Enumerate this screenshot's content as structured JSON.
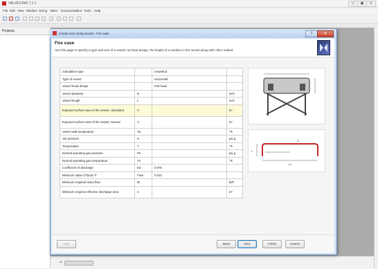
{
  "app": {
    "title": "VALVESTAR 7.2.1",
    "win_controls": [
      "▭",
      "▣",
      "✕"
    ]
  },
  "menu": [
    "File",
    "Edit",
    "View",
    "Medium",
    "Sizing",
    "Valve",
    "Documentation",
    "Tools",
    "Help"
  ],
  "projects_panel": {
    "title": "Projects"
  },
  "dialog": {
    "title": "Create new sizing wizard - Fire case",
    "help_label": "?",
    "close_label": "✕",
    "heading": "Fire case",
    "description": "Use this page to specify a type and size of a vessel, its head design, the height of a medium in the vessel along with other related",
    "rows": [
      {
        "label": "Calculation type",
        "symbol": "",
        "value": "Unwetted",
        "unit": ""
      },
      {
        "label": "Type of vessel",
        "symbol": "",
        "value": "Horizontal",
        "unit": ""
      },
      {
        "label": "Vessel head design",
        "symbol": "",
        "value": "Flat head",
        "unit": ""
      },
      {
        "label": "Vessel diameter",
        "symbol": "D",
        "value": "",
        "unit": "inch"
      },
      {
        "label": "Vessel length",
        "symbol": "L",
        "value": "",
        "unit": "inch"
      },
      {
        "label": "Exposed surface area of the vessel, calculated",
        "symbol": "A'",
        "value": "",
        "unit": "in²",
        "highlight": true
      },
      {
        "label": "Exposed surface area of the vessel, manual",
        "symbol": "A'",
        "value": "",
        "unit": "in²"
      },
      {
        "label": "Vessel wall temperature",
        "symbol": "Tw",
        "value": "",
        "unit": "°R"
      },
      {
        "label": "Set pressure",
        "symbol": "S",
        "value": "",
        "unit": "psi g"
      },
      {
        "label": "Temperature",
        "symbol": "T",
        "value": "",
        "unit": "°R"
      },
      {
        "label": "Normal operating gas pressure",
        "symbol": "Pn",
        "value": "",
        "unit": "psi g"
      },
      {
        "label": "Normal operating gas temperature",
        "symbol": "Tn",
        "value": "",
        "unit": "°R"
      },
      {
        "label": "Coefficient of discharge",
        "symbol": "Kd",
        "value": "0.975",
        "unit": ""
      },
      {
        "label": "Minimum value of factor F'",
        "symbol": "Fmin",
        "value": "0.010",
        "unit": ""
      },
      {
        "label": "Minimum required mass flow",
        "symbol": "W",
        "value": "",
        "unit": "lb/h"
      },
      {
        "label": "Minimum required effective discharge area",
        "symbol": "A",
        "value": "",
        "unit": "in²"
      }
    ],
    "buttons": {
      "help": "Help",
      "back": "Back",
      "next": "Next",
      "finish": "Finish",
      "cancel": "Cancel"
    },
    "diagram_labels": {
      "top": "D",
      "left": "L",
      "bottom": "Lv"
    }
  },
  "colors": {
    "accent": "#c8202a",
    "dialog_frame": "#6f8db8",
    "highlight_row": "#fdfbd6"
  }
}
